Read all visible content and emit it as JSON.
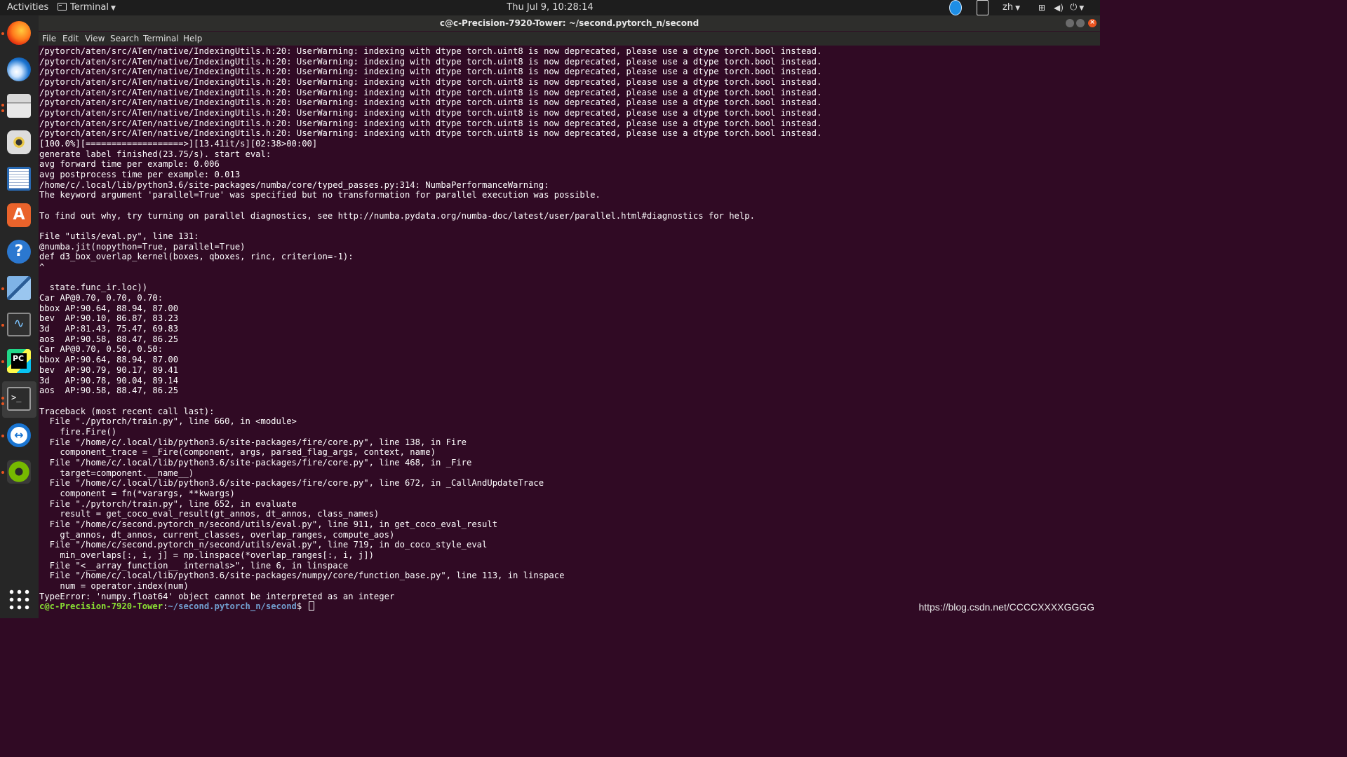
{
  "topbar": {
    "activities": "Activities",
    "app_menu": "Terminal",
    "clock": "Thu Jul  9, 10:28:14",
    "language": "zh",
    "tray_icons": [
      "teamviewer-icon",
      "keyboard-icon",
      "network-icon",
      "volume-icon",
      "power-icon"
    ]
  },
  "window": {
    "title": "c@c-Precision-7920-Tower: ~/second.pytorch_n/second"
  },
  "menubar": {
    "items": [
      "File",
      "Edit",
      "View",
      "Search",
      "Terminal",
      "Help"
    ]
  },
  "dock": {
    "items": [
      "firefox",
      "thunderbird",
      "files",
      "rhythmbox",
      "libreoffice-writer",
      "ubuntu-software",
      "help",
      "remote-desktop",
      "system-monitor",
      "pycharm",
      "terminal",
      "teamviewer",
      "nvidia-settings",
      "show-applications"
    ]
  },
  "terminal": {
    "lines": [
      "/pytorch/aten/src/ATen/native/IndexingUtils.h:20: UserWarning: indexing with dtype torch.uint8 is now deprecated, please use a dtype torch.bool instead.",
      "/pytorch/aten/src/ATen/native/IndexingUtils.h:20: UserWarning: indexing with dtype torch.uint8 is now deprecated, please use a dtype torch.bool instead.",
      "/pytorch/aten/src/ATen/native/IndexingUtils.h:20: UserWarning: indexing with dtype torch.uint8 is now deprecated, please use a dtype torch.bool instead.",
      "/pytorch/aten/src/ATen/native/IndexingUtils.h:20: UserWarning: indexing with dtype torch.uint8 is now deprecated, please use a dtype torch.bool instead.",
      "/pytorch/aten/src/ATen/native/IndexingUtils.h:20: UserWarning: indexing with dtype torch.uint8 is now deprecated, please use a dtype torch.bool instead.",
      "/pytorch/aten/src/ATen/native/IndexingUtils.h:20: UserWarning: indexing with dtype torch.uint8 is now deprecated, please use a dtype torch.bool instead.",
      "/pytorch/aten/src/ATen/native/IndexingUtils.h:20: UserWarning: indexing with dtype torch.uint8 is now deprecated, please use a dtype torch.bool instead.",
      "/pytorch/aten/src/ATen/native/IndexingUtils.h:20: UserWarning: indexing with dtype torch.uint8 is now deprecated, please use a dtype torch.bool instead.",
      "/pytorch/aten/src/ATen/native/IndexingUtils.h:20: UserWarning: indexing with dtype torch.uint8 is now deprecated, please use a dtype torch.bool instead.",
      "[100.0%][===================>][13.41it/s][02:38>00:00]",
      "generate label finished(23.75/s). start eval:",
      "avg forward time per example: 0.006",
      "avg postprocess time per example: 0.013",
      "/home/c/.local/lib/python3.6/site-packages/numba/core/typed_passes.py:314: NumbaPerformanceWarning:",
      "The keyword argument 'parallel=True' was specified but no transformation for parallel execution was possible.",
      "",
      "To find out why, try turning on parallel diagnostics, see http://numba.pydata.org/numba-doc/latest/user/parallel.html#diagnostics for help.",
      "",
      "File \"utils/eval.py\", line 131:",
      "@numba.jit(nopython=True, parallel=True)",
      "def d3_box_overlap_kernel(boxes, qboxes, rinc, criterion=-1):",
      "^",
      "",
      "  state.func_ir.loc))",
      "Car AP@0.70, 0.70, 0.70:",
      "bbox AP:90.64, 88.94, 87.00",
      "bev  AP:90.10, 86.87, 83.23",
      "3d   AP:81.43, 75.47, 69.83",
      "aos  AP:90.58, 88.47, 86.25",
      "Car AP@0.70, 0.50, 0.50:",
      "bbox AP:90.64, 88.94, 87.00",
      "bev  AP:90.79, 90.17, 89.41",
      "3d   AP:90.78, 90.04, 89.14",
      "aos  AP:90.58, 88.47, 86.25",
      "",
      "Traceback (most recent call last):",
      "  File \"./pytorch/train.py\", line 660, in <module>",
      "    fire.Fire()",
      "  File \"/home/c/.local/lib/python3.6/site-packages/fire/core.py\", line 138, in Fire",
      "    component_trace = _Fire(component, args, parsed_flag_args, context, name)",
      "  File \"/home/c/.local/lib/python3.6/site-packages/fire/core.py\", line 468, in _Fire",
      "    target=component.__name__)",
      "  File \"/home/c/.local/lib/python3.6/site-packages/fire/core.py\", line 672, in _CallAndUpdateTrace",
      "    component = fn(*varargs, **kwargs)",
      "  File \"./pytorch/train.py\", line 652, in evaluate",
      "    result = get_coco_eval_result(gt_annos, dt_annos, class_names)",
      "  File \"/home/c/second.pytorch_n/second/utils/eval.py\", line 911, in get_coco_eval_result",
      "    gt_annos, dt_annos, current_classes, overlap_ranges, compute_aos)",
      "  File \"/home/c/second.pytorch_n/second/utils/eval.py\", line 719, in do_coco_style_eval",
      "    min_overlaps[:, i, j] = np.linspace(*overlap_ranges[:, i, j])",
      "  File \"<__array_function__ internals>\", line 6, in linspace",
      "  File \"/home/c/.local/lib/python3.6/site-packages/numpy/core/function_base.py\", line 113, in linspace",
      "    num = operator.index(num)",
      "TypeError: 'numpy.float64' object cannot be interpreted as an integer"
    ],
    "prompt_user": "c@c-Precision-7920-Tower",
    "prompt_sep": ":",
    "prompt_path": "~/second.pytorch_n/second",
    "prompt_symbol": "$ "
  },
  "watermark": "https://blog.csdn.net/CCCCXXXXGGGG",
  "colors": {
    "terminal_bg": "#300a24",
    "prompt_user": "#8ae234",
    "prompt_path": "#729fcf",
    "accent": "#e95420"
  }
}
